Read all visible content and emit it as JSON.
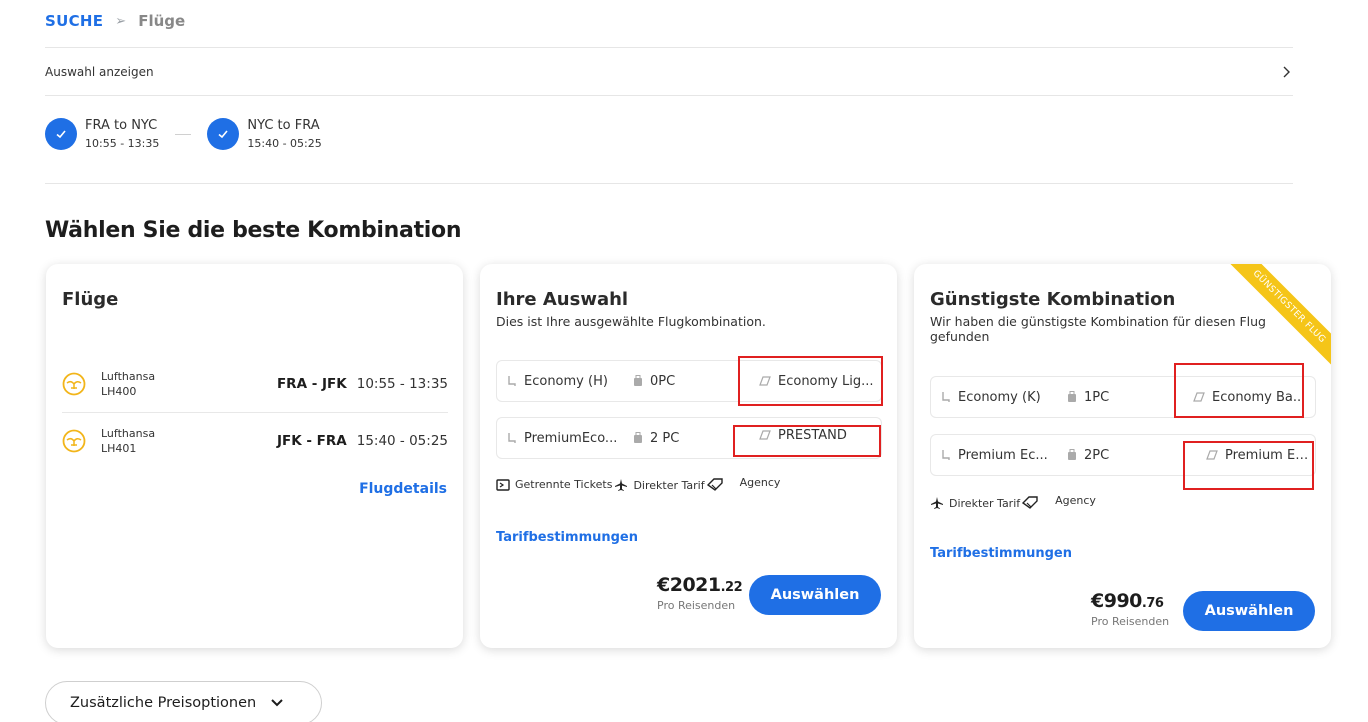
{
  "breadcrumb": {
    "home": "SUCHE",
    "separator": "➢",
    "current": "Flüge"
  },
  "selection": {
    "label": "Auswahl anzeigen"
  },
  "legs": [
    {
      "route": "FRA to NYC",
      "time": "10:55 - 13:35"
    },
    {
      "route": "NYC to FRA",
      "time": "15:40 - 05:25"
    }
  ],
  "section_title": "Wählen Sie die beste Kombination",
  "flights_card": {
    "title": "Flüge",
    "flights": [
      {
        "airline": "Lufthansa",
        "number": "LH400",
        "route": "FRA - JFK",
        "times": "10:55 - 13:35"
      },
      {
        "airline": "Lufthansa",
        "number": "LH401",
        "route": "JFK - FRA",
        "times": "15:40 - 05:25"
      }
    ],
    "details_link": "Flugdetails"
  },
  "selection_card": {
    "title": "Ihre Auswahl",
    "subtitle": "Dies ist Ihre ausgewählte Flugkombination.",
    "rows": [
      {
        "cabin": "Economy (H)",
        "baggage": "0PC",
        "fare": "Economy Lig..."
      },
      {
        "cabin": "PremiumEco...",
        "baggage": "2 PC",
        "fare": "PRESTAND"
      }
    ],
    "features": {
      "tickets": "Getrennte Tickets",
      "tariff": "Direkter Tarif",
      "agency": "Agency"
    },
    "tarif_link": "Tarifbestimmungen",
    "price_main": "€2021",
    "price_cents": ".22",
    "price_sub": "Pro Reisenden",
    "button": "Auswählen"
  },
  "cheapest_card": {
    "title": "Günstigste Kombination",
    "subtitle": "Wir haben die günstigste Kombination für diesen Flug gefunden",
    "ribbon": "GÜNSTIGSTER FLUG",
    "rows": [
      {
        "cabin": "Economy (K)",
        "baggage": "1PC",
        "fare": "Economy Ba..."
      },
      {
        "cabin": "Premium Ec...",
        "baggage": "2PC",
        "fare": "Premium Ec..."
      }
    ],
    "features": {
      "tariff": "Direkter Tarif",
      "agency": "Agency"
    },
    "tarif_link": "Tarifbestimmungen",
    "price_main": "€990",
    "price_cents": ".76",
    "price_sub": "Pro Reisenden",
    "button": "Auswählen"
  },
  "more_options": {
    "label": "Zusätzliche Preisoptionen"
  },
  "colors": {
    "accent": "#1f6fe5",
    "highlight": "#e02020",
    "ribbon": "#f5c518",
    "logo": "#f2b51a"
  }
}
